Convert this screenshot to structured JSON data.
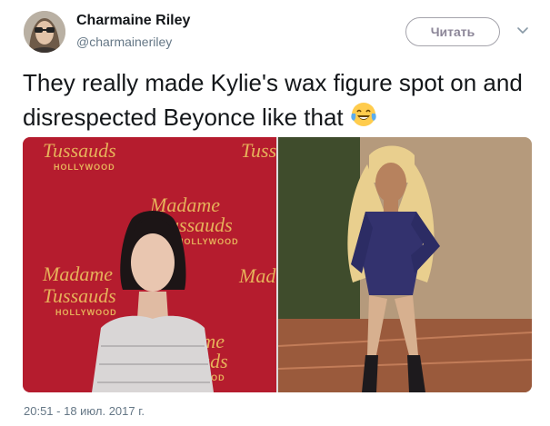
{
  "user": {
    "name": "Charmaine Riley",
    "handle": "@charmaineriley"
  },
  "follow_button": {
    "label": "Читать"
  },
  "menu": {
    "icon": "chevron-down-icon"
  },
  "tweet": {
    "text": "They really made Kylie's wax figure spot on and disrespected Beyonce like that",
    "emoji": "face-with-tears-of-joy"
  },
  "media": {
    "left_backdrop": {
      "brand": "Madame Tussauds",
      "brand_top": "Tussauds",
      "brand_madame": "Madame",
      "location": "HOLLYWOOD"
    }
  },
  "timestamp": "20:51 - 18 июл. 2017 г.",
  "colors": {
    "name": "#14171a",
    "secondary": "#657786",
    "button_border": "#a4a3ab",
    "backdrop_red": "#b0182a",
    "logo_gold": "#e6b15a"
  }
}
